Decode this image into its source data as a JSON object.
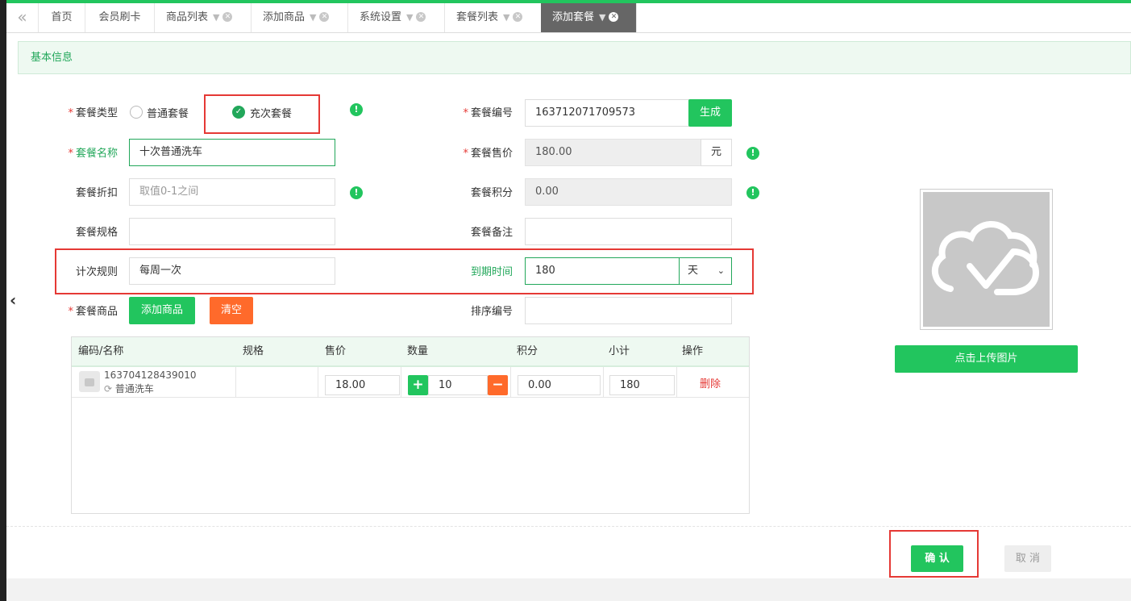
{
  "tabs": {
    "collapse_icon": "double-chevron-left-icon",
    "items": [
      {
        "label": "首页"
      },
      {
        "label": "会员刷卡"
      },
      {
        "label": "商品列表"
      },
      {
        "label": "添加商品"
      },
      {
        "label": "系统设置"
      },
      {
        "label": "套餐列表"
      },
      {
        "label": "添加套餐"
      }
    ],
    "active": "添加套餐"
  },
  "section": {
    "title": "基本信息"
  },
  "form": {
    "type_label": "套餐类型",
    "type_options": [
      "普通套餐",
      "充次套餐"
    ],
    "type_selected": "充次套餐",
    "code_label": "套餐编号",
    "code_value": "163712071709573",
    "generate_button": "生成",
    "name_label": "套餐名称",
    "name_value": "十次普通洗车",
    "price_label": "套餐售价",
    "price_value": "180.00",
    "price_unit": "元",
    "discount_label": "套餐折扣",
    "discount_placeholder": "取值0-1之间",
    "points_label": "套餐积分",
    "points_value": "0.00",
    "spec_label": "套餐规格",
    "spec_value": "",
    "remark_label": "套餐备注",
    "remark_value": "",
    "count_rule_label": "计次规则",
    "count_rule_value": "每周一次",
    "expire_label": "到期时间",
    "expire_value": "180",
    "expire_unit": "天",
    "goods_label": "套餐商品",
    "add_goods_button": "添加商品",
    "clear_button": "清空",
    "sort_label": "排序编号",
    "sort_value": ""
  },
  "table": {
    "headers": [
      "编码/名称",
      "规格",
      "售价",
      "数量",
      "积分",
      "小计",
      "操作"
    ],
    "rows": [
      {
        "code": "163704128439010",
        "name": "普通洗车",
        "spec": "",
        "price": "18.00",
        "qty": "10",
        "points": "0.00",
        "subtotal": "180",
        "action": "删除"
      }
    ]
  },
  "upload": {
    "button": "点击上传图片"
  },
  "footer": {
    "confirm_button": "确 认",
    "cancel_button": "取 消"
  },
  "colors": {
    "accent": "#22c55e",
    "accent_dark": "#22a75a",
    "orange": "#ff6a2b",
    "danger": "#e53935",
    "header_bg": "#eef9f1"
  }
}
